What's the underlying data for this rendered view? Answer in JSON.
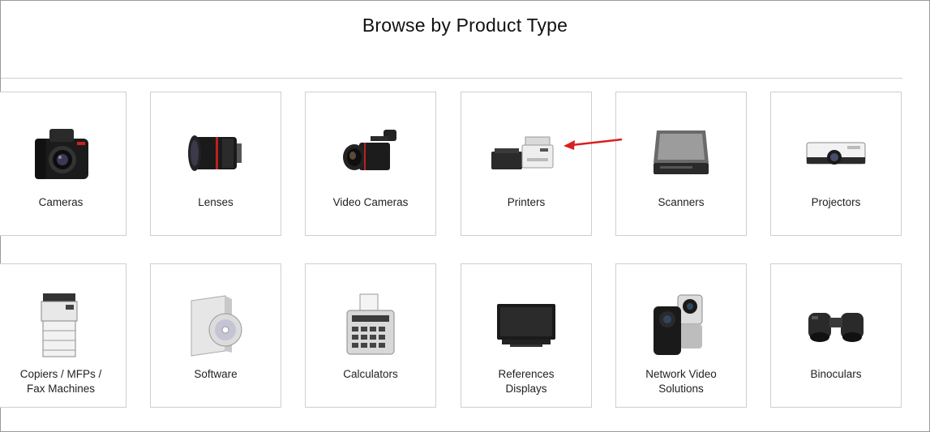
{
  "page": {
    "title": "Browse by Product Type"
  },
  "products": [
    {
      "label": "Cameras",
      "icon": "camera-icon"
    },
    {
      "label": "Lenses",
      "icon": "lens-icon"
    },
    {
      "label": "Video Cameras",
      "icon": "video-camera-icon"
    },
    {
      "label": "Printers",
      "icon": "printer-icon"
    },
    {
      "label": "Scanners",
      "icon": "scanner-icon"
    },
    {
      "label": "Projectors",
      "icon": "projector-icon"
    },
    {
      "label_line1": "Copiers / MFPs /",
      "label_line2": "Fax Machines",
      "icon": "copier-icon"
    },
    {
      "label": "Software",
      "icon": "software-box-icon"
    },
    {
      "label": "Calculators",
      "icon": "calculator-icon"
    },
    {
      "label_line1": "References",
      "label_line2": "Displays",
      "icon": "monitor-icon"
    },
    {
      "label_line1": "Network Video",
      "label_line2": "Solutions",
      "icon": "network-camera-icon"
    },
    {
      "label": "Binoculars",
      "icon": "binoculars-icon"
    }
  ],
  "annotation": {
    "icon": "red-arrow-icon",
    "color": "#d9201f"
  }
}
